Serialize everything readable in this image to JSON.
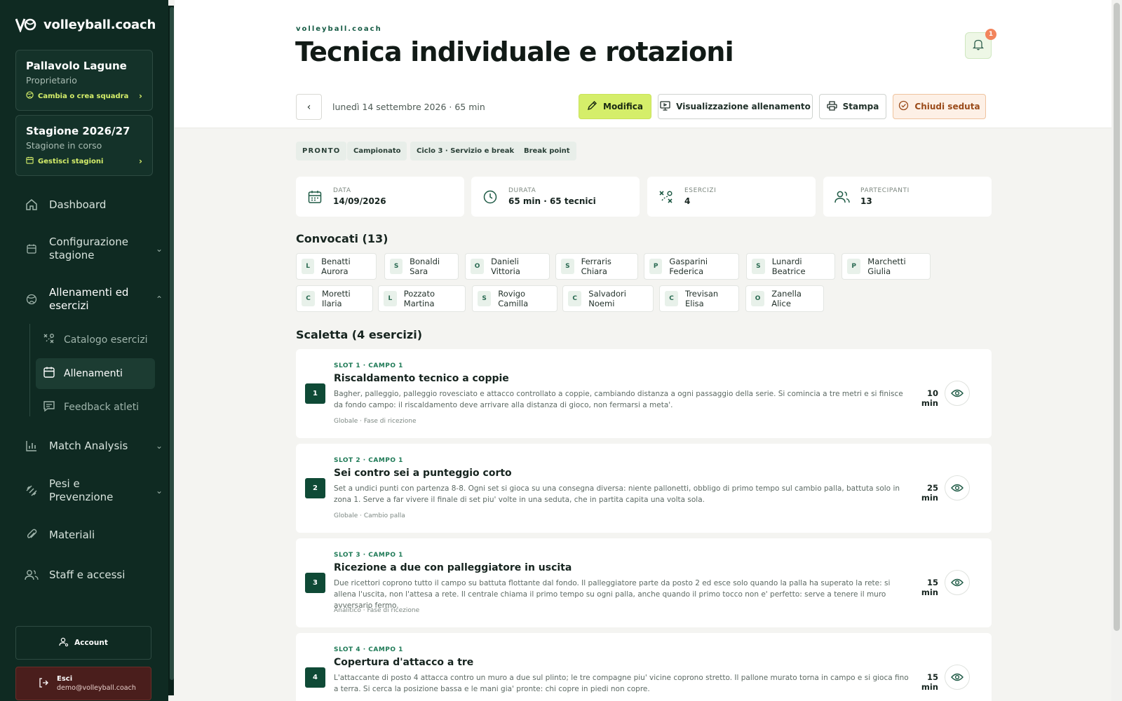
{
  "sidebar": {
    "brand": "volleyball.coach",
    "team": {
      "name": "Pallavolo Lagune",
      "role": "Proprietario",
      "action": "Cambia o crea squadra"
    },
    "season": {
      "name": "Stagione 2026/27",
      "status": "Stagione in corso",
      "action": "Gestisci stagioni"
    },
    "nav": [
      {
        "label": "Dashboard",
        "icon": "home-icon"
      },
      {
        "label": "Configurazione stagione",
        "icon": "calendar-icon"
      },
      {
        "label": "Allenamenti ed esercizi",
        "icon": "volleyball-icon"
      },
      {
        "label": "Match Analysis",
        "icon": "bar-chart-icon"
      },
      {
        "label": "Pesi e Prevenzione",
        "icon": "dumbbell-icon"
      },
      {
        "label": "Materiali",
        "icon": "paperclip-icon"
      },
      {
        "label": "Staff e accessi",
        "icon": "users-icon"
      }
    ],
    "subnav": [
      {
        "label": "Catalogo esercizi",
        "icon": "drill-icon"
      },
      {
        "label": "Allenamenti",
        "icon": "calendar-icon"
      },
      {
        "label": "Feedback atleti",
        "icon": "message-icon"
      }
    ],
    "account_label": "Account",
    "logout": {
      "label": "Esci",
      "email": "demo@volleyball.coach"
    }
  },
  "header": {
    "eyebrow": "volleyball.coach",
    "title": "Tecnica individuale e rotazioni",
    "notifications": "1",
    "meta": "lunedì 14 settembre 2026 · 65 min",
    "actions": {
      "edit": "Modifica",
      "view": "Visualizzazione allenamento",
      "print": "Stampa",
      "close": "Chiudi seduta"
    }
  },
  "tags": [
    "PRONTO",
    "Campionato",
    "Ciclo 3 · Servizio e break",
    "Break point"
  ],
  "stats": [
    {
      "label": "DATA",
      "value": "14/09/2026",
      "icon": "calendar-icon"
    },
    {
      "label": "DURATA",
      "value": "65 min · 65 tecnici",
      "icon": "clock-icon"
    },
    {
      "label": "ESERCIZI",
      "value": "4",
      "icon": "drill-icon"
    },
    {
      "label": "PARTECIPANTI",
      "value": "13",
      "icon": "users-icon"
    }
  ],
  "convocati": {
    "title": "Convocati (13)",
    "players": [
      {
        "role": "L",
        "name": "Benatti Aurora"
      },
      {
        "role": "S",
        "name": "Bonaldi Sara"
      },
      {
        "role": "O",
        "name": "Danieli Vittoria"
      },
      {
        "role": "S",
        "name": "Ferraris Chiara"
      },
      {
        "role": "P",
        "name": "Gasparini Federica"
      },
      {
        "role": "S",
        "name": "Lunardi Beatrice"
      },
      {
        "role": "P",
        "name": "Marchetti Giulia"
      },
      {
        "role": "C",
        "name": "Moretti Ilaria"
      },
      {
        "role": "L",
        "name": "Pozzato Martina"
      },
      {
        "role": "S",
        "name": "Rovigo Camilla"
      },
      {
        "role": "C",
        "name": "Salvadori Noemi"
      },
      {
        "role": "C",
        "name": "Trevisan Elisa"
      },
      {
        "role": "O",
        "name": "Zanella Alice"
      }
    ]
  },
  "scaletta": {
    "title": "Scaletta (4 esercizi)",
    "items": [
      {
        "num": "1",
        "slot": "SLOT 1 · CAMPO 1",
        "title": "Riscaldamento tecnico a coppie",
        "desc": "Bagher, palleggio, palleggio rovesciato e attacco controllato a coppie, cambiando distanza a ogni passaggio della serie. Si comincia a tre metri e si finisce da fondo campo: il riscaldamento deve arrivare alla distanza di gioco, non fermarsi a meta'.",
        "foot": "Globale · Fase di ricezione",
        "duration": "10 min"
      },
      {
        "num": "2",
        "slot": "SLOT 2 · CAMPO 1",
        "title": "Sei contro sei a punteggio corto",
        "desc": "Set a undici punti con partenza 8-8. Ogni set si gioca su una consegna diversa: niente pallonetti, obbligo di primo tempo sul cambio palla, battuta solo in zona 1. Serve a far vivere il finale di set piu' volte in una seduta, che in partita capita una volta sola.",
        "foot": "Globale · Cambio palla",
        "duration": "25 min"
      },
      {
        "num": "3",
        "slot": "SLOT 3 · CAMPO 1",
        "title": "Ricezione a due con palleggiatore in uscita",
        "desc": "Due ricettori coprono tutto il campo su battuta flottante dal fondo. Il palleggiatore parte da posto 2 ed esce solo quando la palla ha superato la rete: si allena l'uscita, non l'attesa a rete. Il centrale chiama il primo tempo su ogni palla, anche quando il primo tocco non e' perfetto: serve a tenere il muro avversario fermo.",
        "foot": "Analitico · Fase di ricezione",
        "duration": "15 min"
      },
      {
        "num": "4",
        "slot": "SLOT 4 · CAMPO 1",
        "title": "Copertura d'attacco a tre",
        "desc": "L'attaccante di posto 4 attacca contro un muro a due sul plinto; le tre compagne piu' vicine coprono stretto. Il pallone murato torna in campo e si gioca fino a terra. Si cerca la posizione bassa e le mani gia' pronte: chi copre in piedi non copre.",
        "foot": "",
        "duration": "15 min"
      }
    ]
  },
  "colors": {
    "sidebar_bg": "#0f2a22",
    "accent": "#d5ee6a",
    "primary_dark": "#0f4a36",
    "warning": "#9a4b1a"
  }
}
